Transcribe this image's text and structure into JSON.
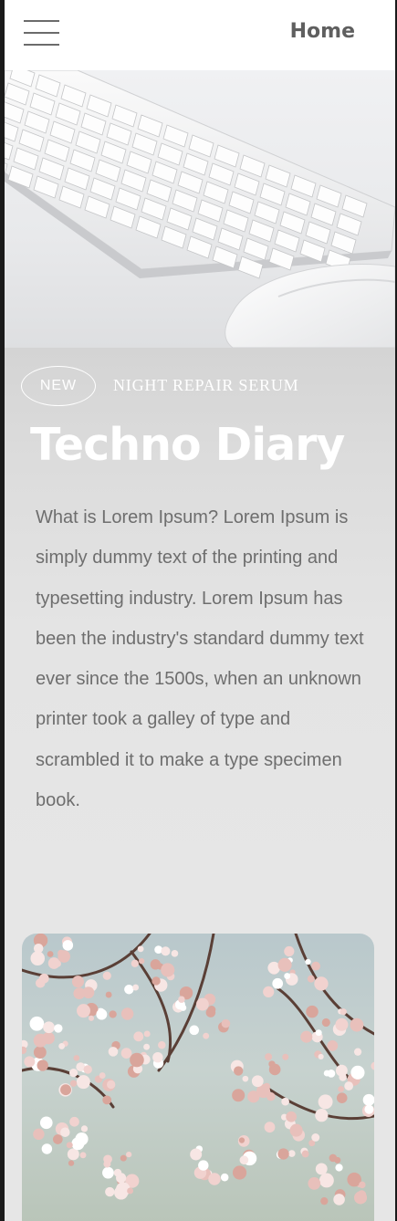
{
  "header": {
    "menu_icon": "hamburger-menu-icon",
    "title": "Home"
  },
  "hero": {
    "image": "keyboard-and-mouse-photo"
  },
  "article": {
    "badge": "NEW",
    "subtitle": "NIGHT REPAIR SERUM",
    "title": "Techno Diary",
    "body": "What is Lorem Ipsum? Lorem Ipsum is simply dummy text of the printing and typesetting industry. Lorem Ipsum has been the industry's standard dummy text ever since the 1500s, when an unknown printer took a galley of type and scrambled it to make a type specimen book."
  },
  "card": {
    "image": "cherry-blossom-photo"
  },
  "colors": {
    "header_bg": "#ffffff",
    "header_text": "#5f5f5f",
    "page_bg": "#e6e6e6",
    "title_text": "#ffffff",
    "body_text": "#6e6e6e"
  }
}
